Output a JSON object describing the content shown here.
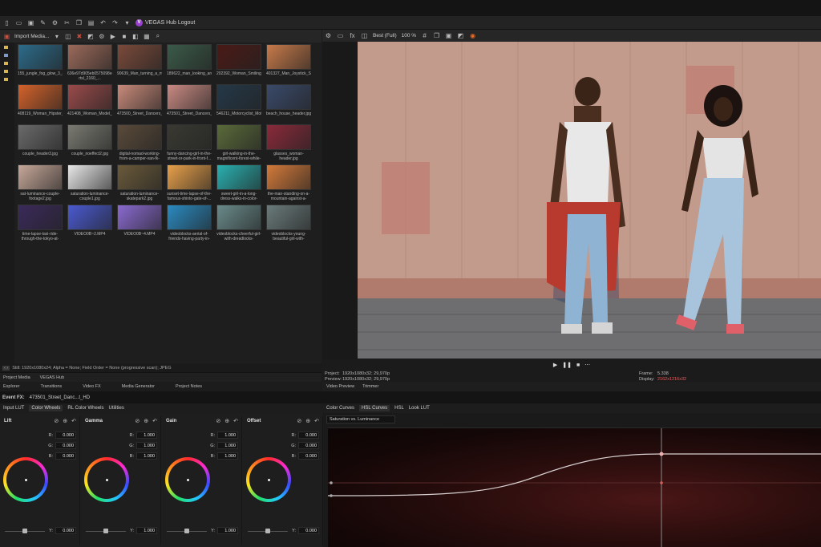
{
  "app": {
    "hub_label": "VEGAS Hub Logout"
  },
  "media": {
    "import_label": "Import Media...",
    "thumbs": [
      {
        "caption": "155_jungle_fog_glow_3_4_sphinxmask_2160_...",
        "color": "#2c6b8a"
      },
      {
        "caption": "636e97d905eb0575098e8f0_dl_b1sy1-rtsl_2160_...",
        "color": "#9b6a5a"
      },
      {
        "caption": "90639_Man_turning_a_movie_projector_lens_B...",
        "color": "#7a4a3a"
      },
      {
        "caption": "189622_man_looking_around_and_smiling_By_...",
        "color": "#3a5a48"
      },
      {
        "caption": "202392_Woman_Smiling_Laughing_Projector_By_...",
        "color": "#4a1a16"
      },
      {
        "caption": "401327_Man_Joystick_Sea_Beach_By_John_Rich...",
        "color": "#c77a4a"
      },
      {
        "caption": "408119_Woman_Hipster_Polaroid_Camera_By_Pi...",
        "color": "#d4622a"
      },
      {
        "caption": "421408_Woman_Model_Hand_and_Performance_Sittin...",
        "color": "#9a4a4a"
      },
      {
        "caption": "473500_Street_Dancers_Dancing_Jeans_Legs_B...",
        "color": "#c98a7a"
      },
      {
        "caption": "473501_Street_Dancers_Friends_Dancing_Music_...",
        "color": "#c98a82"
      },
      {
        "caption": "546211_Motorcyclist_Motorcycle_Garage_Helmet...",
        "color": "#243848"
      },
      {
        "caption": "beach_house_header.jpg",
        "color": "#3a4a6a"
      },
      {
        "caption": "couple_header3.jpg",
        "color": "#6a6a6a"
      },
      {
        "caption": "couple_noeffect2.jpg",
        "color": "#7a7a72"
      },
      {
        "caption": "digital-nomad-working-from-a-camper-van-fk-gra...",
        "color": "#5a4a3a"
      },
      {
        "caption": "funny-dancing-girl-in-the-street-or-park-in-front-f...",
        "color": "#3a3a32"
      },
      {
        "caption": "girl-walking-in-the-magnificent-forest-while-relaxi...",
        "color": "#5a6a3a"
      },
      {
        "caption": "glasses_woman-header.jpg",
        "color": "#8a2a3a"
      },
      {
        "caption": "sat-luminance-couple-footage2.jpg",
        "color": "#c7a89a"
      },
      {
        "caption": "saturation-luminance-couple1.jpg",
        "color": "#e8e8e8"
      },
      {
        "caption": "saturation-luminance-skatepark2.jpg",
        "color": "#6a5a3a"
      },
      {
        "caption": "sunset-time-lapse-of-the-famous-shinto-gate-of-...",
        "color": "#e8a04a"
      },
      {
        "caption": "sweet-girl-in-a-long-dress-walks-in-color-smoke-ri...",
        "color": "#2ab0b0"
      },
      {
        "caption": "the-man-standing-on-a-mountain-against-a-pictur...",
        "color": "#d47a3a"
      },
      {
        "caption": "time-lapse-taxi-ride-through-the-tokyo-at-night_E...",
        "color": "#3a2a5a"
      },
      {
        "caption": "VIDEO0B~2.MP4",
        "color": "#4a5ad0"
      },
      {
        "caption": "VIDEO0B~4.MP4",
        "color": "#8a6ad0"
      },
      {
        "caption": "videoblocks-aerial-of-friends-having-party-in-swim...",
        "color": "#2a8ac0"
      },
      {
        "caption": "videoblocks-cheerful-girl-with-dreadlocks-dancing...",
        "color": "#6a8a8a"
      },
      {
        "caption": "videoblocks-young-beautiful-girl-with-african-hair-...",
        "color": "#6a7a7a"
      }
    ],
    "status": "Still: 1920x1080x24; Alpha = None; Field Order = None (progressive scan); JPEG",
    "window_tabs": [
      "Project Media",
      "VEGAS Hub"
    ],
    "bottom_tabs": [
      "Explorer",
      "Transitions",
      "Video FX",
      "Media Generator",
      "Project Notes"
    ]
  },
  "preview": {
    "quality": "Best (Full)",
    "zoom": "100 %",
    "project_label": "Project:",
    "project_value": "1920x1080x32; 29,970p",
    "preview_label": "Preview:",
    "preview_value": "1920x1080x32; 29,970p",
    "frame_label": "Frame:",
    "frame_value": "5.338",
    "display_label": "Display:",
    "display_value": "2162x1216x32",
    "tabs": [
      "Video Preview",
      "Trimmer"
    ]
  },
  "event_fx": {
    "label": "Event FX:",
    "clip": "473501_Street_Danc...t_HD"
  },
  "color_tabs": [
    "Input LUT",
    "Color Wheels",
    "RL Color Wheels",
    "Utilities"
  ],
  "wheels": [
    {
      "title": "Lift",
      "r": "0.000",
      "g": "0.000",
      "b": "0.000",
      "y": "0.000"
    },
    {
      "title": "Gamma",
      "r": "1.000",
      "g": "1.000",
      "b": "1.000",
      "y": "1.000"
    },
    {
      "title": "Gain",
      "r": "1.000",
      "g": "1.000",
      "b": "1.000",
      "y": "1.000"
    },
    {
      "title": "Offset",
      "r": "0.000",
      "g": "0.000",
      "b": "0.000",
      "y": "0.000"
    }
  ],
  "channel_labels": {
    "r": "R:",
    "g": "G:",
    "b": "B:",
    "y": "Y:"
  },
  "curve_tabs": [
    "Color Curves",
    "HSL Curves",
    "HSL",
    "Look LUT"
  ],
  "curve_mode": "Saturation vs. Luminance"
}
